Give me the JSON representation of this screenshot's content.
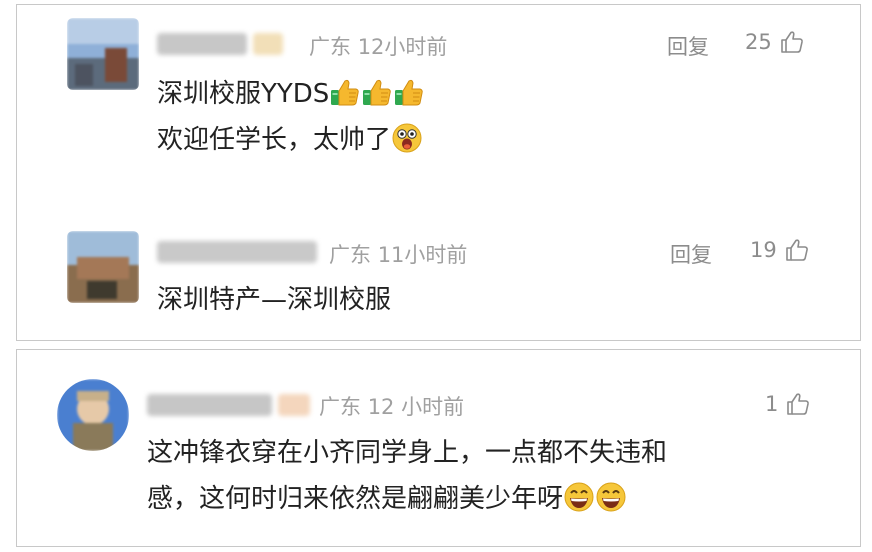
{
  "comments": [
    {
      "location": "广东",
      "time": "12小时前",
      "reply_label": "回复",
      "likes": "25",
      "line1": "深圳校服YYDS",
      "line2": "欢迎任学长，太帅了",
      "emojis_line1": [
        "thumbs-up-icon",
        "thumbs-up-icon",
        "thumbs-up-icon"
      ],
      "emojis_line2": [
        "surprised-face-icon"
      ]
    },
    {
      "location": "广东",
      "time": "11小时前",
      "reply_label": "回复",
      "likes": "19",
      "line1": "深圳特产—深圳校服"
    },
    {
      "location": "广东",
      "time": "12 小时前",
      "likes": "1",
      "line1": "这冲锋衣穿在小齐同学身上，一点都不失违和",
      "line2": "感，这何时归来依然是翩翩美少年呀",
      "emojis_line2": [
        "grinning-face-icon",
        "grinning-face-icon"
      ]
    }
  ],
  "colors": {
    "meta": "#a0a0a0",
    "text": "#222222",
    "border": "#c8c8c8"
  }
}
